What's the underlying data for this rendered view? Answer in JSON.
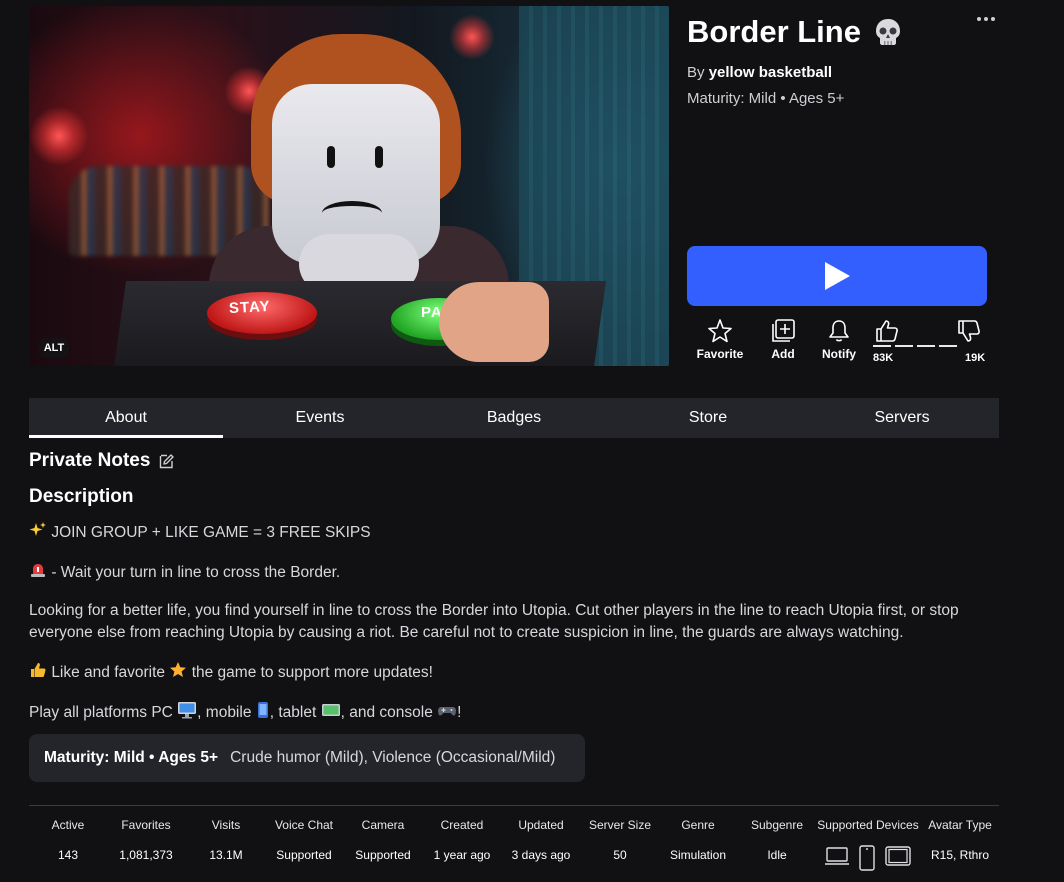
{
  "game": {
    "title": "Border Line",
    "title_emoji": "skull-icon",
    "by_prefix": "By",
    "creator": "yellow basketball",
    "maturity_line": "Maturity: Mild • Ages 5+",
    "thumbnail": {
      "alt_badge": "ALT",
      "button_left_label": "STAY",
      "button_right_label": "PA"
    }
  },
  "actions": {
    "favorite": "Favorite",
    "add": "Add",
    "notify": "Notify",
    "upvotes": "83K",
    "downvotes": "19K"
  },
  "tabs": [
    {
      "label": "About",
      "active": true
    },
    {
      "label": "Events",
      "active": false
    },
    {
      "label": "Badges",
      "active": false
    },
    {
      "label": "Store",
      "active": false
    },
    {
      "label": "Servers",
      "active": false
    }
  ],
  "private_notes_heading": "Private Notes",
  "description": {
    "heading": "Description",
    "line1": "JOIN GROUP + LIKE GAME = 3 FREE SKIPS",
    "line2": "- Wait your turn in line to cross the Border.",
    "line3": "Looking for a better life, you find yourself in line to cross the Border into Utopia. Cut other players in the line to reach Utopia first, or stop everyone else from reaching Utopia by causing a riot. Be careful not to create suspicion in line, the guards are always watching.",
    "line4a": "Like and favorite",
    "line4b": "the game to support more updates!",
    "line5a": "Play all platforms PC",
    "line5b": ", mobile",
    "line5c": ", tablet",
    "line5d": ", and console",
    "line5e": "!"
  },
  "maturity_box": {
    "label": "Maturity: Mild • Ages 5+",
    "descriptors": "Crude humor (Mild), Violence (Occasional/Mild)"
  },
  "stats": [
    {
      "label": "Active",
      "value": "143"
    },
    {
      "label": "Favorites",
      "value": "1,081,373"
    },
    {
      "label": "Visits",
      "value": "13.1M"
    },
    {
      "label": "Voice Chat",
      "value": "Supported"
    },
    {
      "label": "Camera",
      "value": "Supported"
    },
    {
      "label": "Created",
      "value": "1 year ago"
    },
    {
      "label": "Updated",
      "value": "3 days ago"
    },
    {
      "label": "Server Size",
      "value": "50"
    },
    {
      "label": "Genre",
      "value": "Simulation"
    },
    {
      "label": "Subgenre",
      "value": "Idle"
    },
    {
      "label": "Supported Devices",
      "value": ""
    },
    {
      "label": "Avatar Type",
      "value": "R15, Rthro"
    }
  ],
  "colors": {
    "play_button": "#335fff",
    "background": "#111114",
    "tab_bar": "#23252b"
  }
}
